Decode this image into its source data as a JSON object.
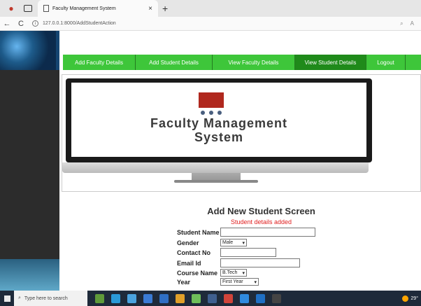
{
  "browser": {
    "tab_title": "Faculty Management System",
    "tab_close": "×",
    "new_tab": "+",
    "url": "127.0.0.1:8000/AddStudentAction",
    "back": "←",
    "reload": "C",
    "info": "i"
  },
  "menu": {
    "items": [
      {
        "label": "Add Faculty Details"
      },
      {
        "label": "Add Student Details"
      },
      {
        "label": "View Faculty Details"
      },
      {
        "label": "View Student Details"
      },
      {
        "label": "Logout"
      }
    ]
  },
  "banner": {
    "line1": "Faculty Management",
    "line2": "System"
  },
  "form": {
    "title": "Add New Student Screen",
    "message": "Student details added",
    "fields": {
      "student_name": {
        "label": "Student Name",
        "value": ""
      },
      "gender": {
        "label": "Gender",
        "value": "Male"
      },
      "contact": {
        "label": "Contact No",
        "value": ""
      },
      "email": {
        "label": "Email Id",
        "value": ""
      },
      "course": {
        "label": "Course Name",
        "value": "B.Tech"
      },
      "year": {
        "label": "Year",
        "value": "First Year"
      }
    }
  },
  "taskbar": {
    "search_placeholder": "Type here to search",
    "temperature": "29°"
  },
  "colors": {
    "menu_green": "#3ec63a",
    "menu_dark_green": "#1f8a1a",
    "message_red": "#e02020",
    "logo_red": "#b0281e"
  }
}
